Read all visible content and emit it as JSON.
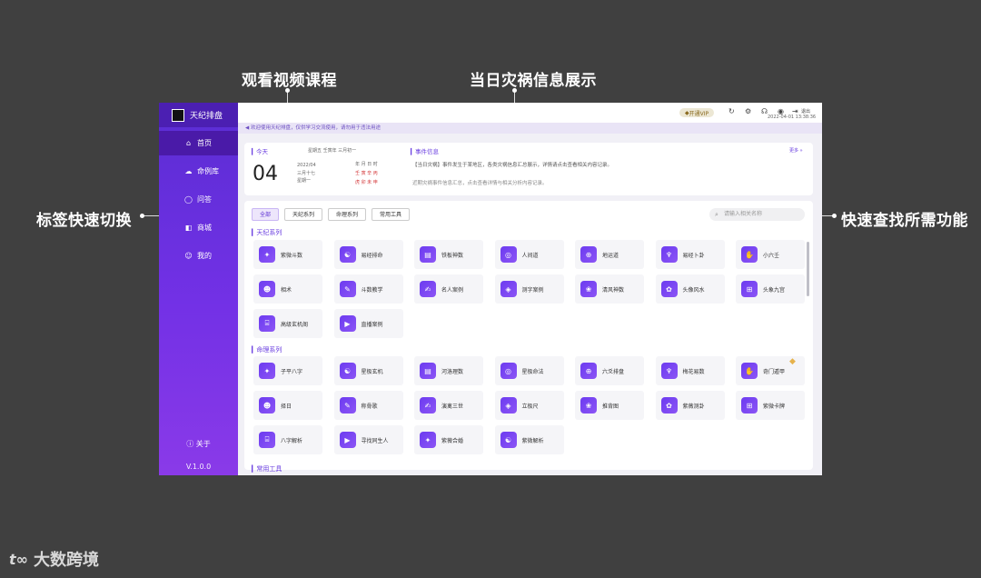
{
  "callouts": {
    "video": "观看视频课程",
    "disaster": "当日灾祸信息展示",
    "tags": "标签快速切换",
    "search": "快速查找所需功能"
  },
  "sidebar": {
    "brand": "天纪排盘",
    "items": [
      {
        "label": "首页",
        "icon": "home-icon",
        "glyph": "⌂"
      },
      {
        "label": "命例库",
        "icon": "cloud-icon",
        "glyph": "☁"
      },
      {
        "label": "问答",
        "icon": "chat-icon",
        "glyph": "◯"
      },
      {
        "label": "商城",
        "icon": "shop-icon",
        "glyph": "◧"
      },
      {
        "label": "我的",
        "icon": "user-icon",
        "glyph": "☺"
      }
    ],
    "about": "关于",
    "version": "V.1.0.0"
  },
  "topbar": {
    "vip": "开通VIP",
    "date": "2022-04-01  13:38:36",
    "logout": "退出"
  },
  "notice": "欢迎使用天纪排盘，仅供学习交流使用，请勿用于违法用途",
  "today": {
    "label": "今天",
    "header": "星期五 壬寅年 三月初一",
    "day": "04",
    "date_small": "2022/04",
    "lunar": "三月十七",
    "weekday": "星期一",
    "yi": "年 月 日 时",
    "gz1": "壬 寅 辛 丙",
    "gz2": "虎 卯 未 申"
  },
  "event": {
    "label": "事件信息",
    "more": "更多 »",
    "text": "【当日灾祸】事件发生于某地区，各类灾祸信息汇总展示，详情请点击查看相关内容记录。",
    "sub": "近期灾祸事件信息汇总，点击查看详情与相关分析内容记录。"
  },
  "tabs": [
    "全部",
    "天纪系列",
    "命理系列",
    "常用工具"
  ],
  "search_placeholder": "请输入相关名称",
  "groups": [
    {
      "title": "天纪系列",
      "items": [
        "紫微斗数",
        "易经排命",
        "铁板神数",
        "人间道",
        "地运道",
        "易经卜卦",
        "小六壬",
        "相术",
        "斗数教学",
        "名人案例",
        "测字案例",
        "清风神数",
        "头像风水",
        "头象九宫",
        "高级玄机阁",
        "直播案例"
      ]
    },
    {
      "title": "命理系列",
      "items": [
        "子平八字",
        "星极玄机",
        "河洛理数",
        "星极命法",
        "六爻排盘",
        "梅花易数",
        "奇门遁甲",
        "择日",
        "称骨歌",
        "演禽三世",
        "立极尺",
        "推背图",
        "紫薇测卦",
        "紫微卡牌",
        "八字解析",
        "寻找同生人",
        "紫薇合婚",
        "紫微解析"
      ]
    },
    {
      "title": "常用工具",
      "items": []
    }
  ],
  "watermark": "大数跨境"
}
